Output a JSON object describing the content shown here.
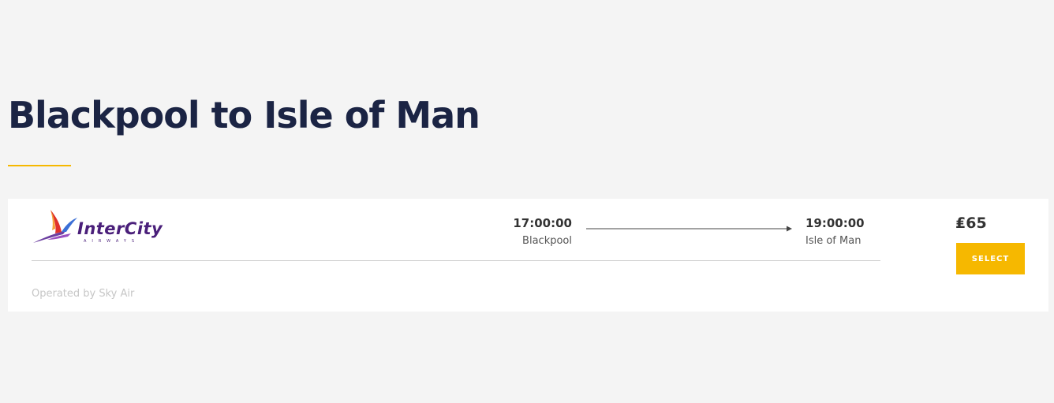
{
  "route": {
    "title": "Blackpool to Isle of Man"
  },
  "flight": {
    "airline": {
      "name": "InterCity",
      "subtitle": "AIRWAYS",
      "logo_icon": "bird-logo-icon",
      "colors": {
        "text": "#4a1f7a",
        "bird_red": "#e0312b",
        "bird_purple": "#6b3fa0"
      }
    },
    "departure": {
      "time": "17:00:00",
      "city": "Blackpool"
    },
    "arrival": {
      "time": "19:00:00",
      "city": "Isle of Man"
    },
    "arrow_icon": "arrow-right-icon",
    "price": "₤65",
    "select_label": "SELECT",
    "operated_by": "Operated by Sky Air"
  },
  "colors": {
    "background": "#f4f4f4",
    "title": "#1b2444",
    "accent": "#f6b800",
    "card": "#ffffff"
  }
}
